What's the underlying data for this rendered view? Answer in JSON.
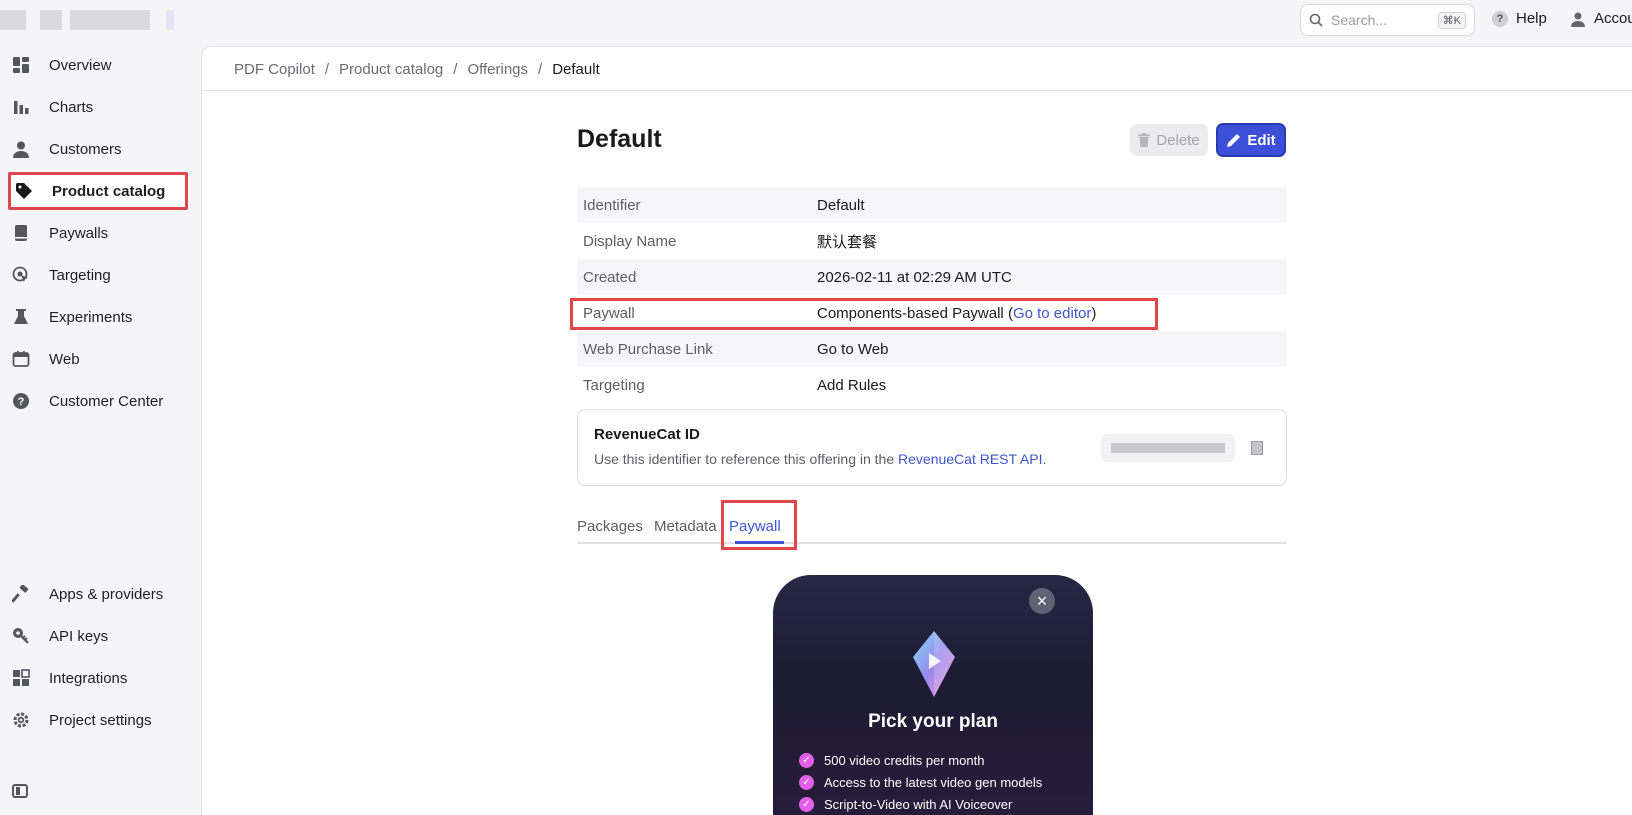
{
  "topbar": {
    "search_placeholder": "Search...",
    "search_shortcut": "⌘K",
    "help_label": "Help",
    "account_label": "Accou"
  },
  "sidebar": {
    "items": [
      {
        "label": "Overview",
        "icon": "grid-icon"
      },
      {
        "label": "Charts",
        "icon": "bar-chart-icon"
      },
      {
        "label": "Customers",
        "icon": "person-icon"
      },
      {
        "label": "Product catalog",
        "icon": "tag-icon"
      },
      {
        "label": "Paywalls",
        "icon": "book-icon"
      },
      {
        "label": "Targeting",
        "icon": "target-icon"
      },
      {
        "label": "Experiments",
        "icon": "flask-icon"
      },
      {
        "label": "Web",
        "icon": "calendar-icon"
      },
      {
        "label": "Customer Center",
        "icon": "support-icon"
      }
    ],
    "bottom_items": [
      {
        "label": "Apps & providers",
        "icon": "hammer-icon"
      },
      {
        "label": "API keys",
        "icon": "key-icon"
      },
      {
        "label": "Integrations",
        "icon": "puzzle-icon"
      },
      {
        "label": "Project settings",
        "icon": "gear-icon"
      }
    ],
    "active": "Product catalog"
  },
  "breadcrumb": {
    "items": [
      "PDF Copilot",
      "Product catalog",
      "Offerings"
    ],
    "current": "Default",
    "separator": "/"
  },
  "page": {
    "title": "Default",
    "delete_label": "Delete",
    "edit_label": "Edit"
  },
  "details": {
    "identifier_key": "Identifier",
    "identifier_value": "Default",
    "display_name_key": "Display Name",
    "display_name_value": "默认套餐",
    "created_key": "Created",
    "created_value": "2026-02-11 at 02:29 AM UTC",
    "paywall_key": "Paywall",
    "paywall_value": "Components-based Paywall",
    "paywall_link": "Go to editor",
    "web_key": "Web Purchase Link",
    "web_link": "Go to Web",
    "targeting_key": "Targeting",
    "targeting_link": "Add Rules"
  },
  "rc_id": {
    "title": "RevenueCat ID",
    "description": "Use this identifier to reference this offering in the",
    "link": "RevenueCat REST API",
    "suffix": "."
  },
  "tabs": [
    "Packages",
    "Metadata",
    "Paywall"
  ],
  "active_tab": "Paywall",
  "preview": {
    "headline": "Pick your plan",
    "features": [
      "500 video credits per month",
      "Access to the latest video gen models",
      "Script-to-Video with AI Voiceover"
    ],
    "accent": "#e45fe8"
  },
  "colors": {
    "accent": "#3e56cf",
    "highlight": "#e0464b"
  }
}
